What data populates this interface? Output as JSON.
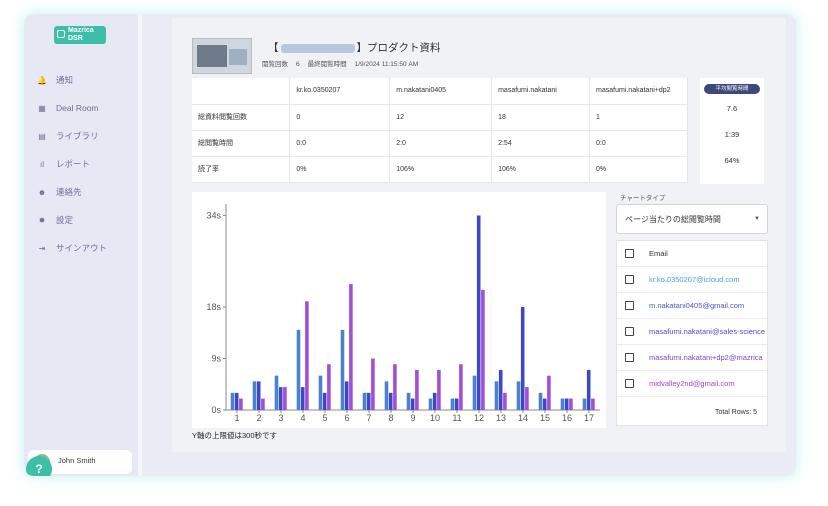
{
  "sidebar": {
    "logo": "Mazrica DSR",
    "items": [
      {
        "icon": "bell-icon",
        "glyph": "🔔",
        "label": "通知"
      },
      {
        "icon": "building-icon",
        "glyph": "▦",
        "label": "Deal Room"
      },
      {
        "icon": "library-icon",
        "glyph": "▤",
        "label": "ライブラリ"
      },
      {
        "icon": "bar-chart-icon",
        "glyph": "ıl",
        "label": "レポート"
      },
      {
        "icon": "contact-icon",
        "glyph": "☻",
        "label": "連絡先"
      },
      {
        "icon": "gear-icon",
        "glyph": "✹",
        "label": "設定"
      },
      {
        "icon": "signout-icon",
        "glyph": "⇥",
        "label": "サインアウト"
      }
    ],
    "user": "John Smith",
    "help": "?"
  },
  "document": {
    "title_prefix": "【",
    "title_suffix": "】プロダクト資料",
    "views_label": "閲覧回数",
    "views": "6",
    "last_viewed_label": "最終閲覧時間",
    "last_viewed": "1/9/2024 11:15:50 AM"
  },
  "stats": {
    "columns": [
      "kr.ko.0350207",
      "m.nakatani0405",
      "masafumi.nakatani",
      "masafumi.nakatani+dp2"
    ],
    "rows": [
      {
        "label": "総資料閲覧回数",
        "values": [
          "0",
          "12",
          "18",
          "1"
        ]
      },
      {
        "label": "総閲覧時間",
        "values": [
          "0:0",
          "2:0",
          "2:54",
          "0:0"
        ]
      },
      {
        "label": "読了率",
        "values": [
          "0%",
          "106%",
          "106%",
          "0%"
        ]
      }
    ],
    "avg_label": "平均閲覧時間",
    "avg_values": [
      "7.6",
      "1:39",
      "64%"
    ]
  },
  "chart_type_label": "チャートタイプ",
  "chart_type_value": "ページ当たりの総閲覧時間",
  "emails": {
    "header": "Email",
    "items": [
      {
        "text": "kr.ko.0350207@icloud.com",
        "color": "#4a9fd6"
      },
      {
        "text": "m.nakatani0405@gmail.com",
        "color": "#4a56c8"
      },
      {
        "text": "masafumi.nakatani@sales-science",
        "color": "#5a46c8"
      },
      {
        "text": "masafumi.nakatani+dp2@mazrica",
        "color": "#7a46c8"
      },
      {
        "text": "midvalley2nd@gmail.com",
        "color": "#a046c8"
      }
    ],
    "total": "Total Rows: 5"
  },
  "note": "Y軸の上限値は300秒です",
  "chart_data": {
    "type": "bar",
    "categories": [
      "1",
      "2",
      "3",
      "4",
      "5",
      "6",
      "7",
      "8",
      "9",
      "10",
      "11",
      "12",
      "13",
      "14",
      "15",
      "16",
      "17"
    ],
    "yticks": [
      "0s",
      "9s",
      "18s",
      "34s"
    ],
    "ylim": [
      0,
      36
    ],
    "series": [
      {
        "color": "#4a82d0",
        "values": [
          3,
          5,
          6,
          14,
          6,
          14,
          3,
          5,
          3,
          2,
          2,
          6,
          5,
          5,
          3,
          2,
          2
        ]
      },
      {
        "color": "#3f48c4",
        "values": [
          3,
          5,
          4,
          4,
          3,
          5,
          3,
          3,
          2,
          3,
          2,
          34,
          7,
          18,
          2,
          2,
          7
        ]
      },
      {
        "color": "#a24fd6",
        "values": [
          2,
          2,
          4,
          19,
          8,
          22,
          9,
          8,
          7,
          7,
          8,
          21,
          3,
          4,
          6,
          2,
          2
        ]
      }
    ]
  }
}
